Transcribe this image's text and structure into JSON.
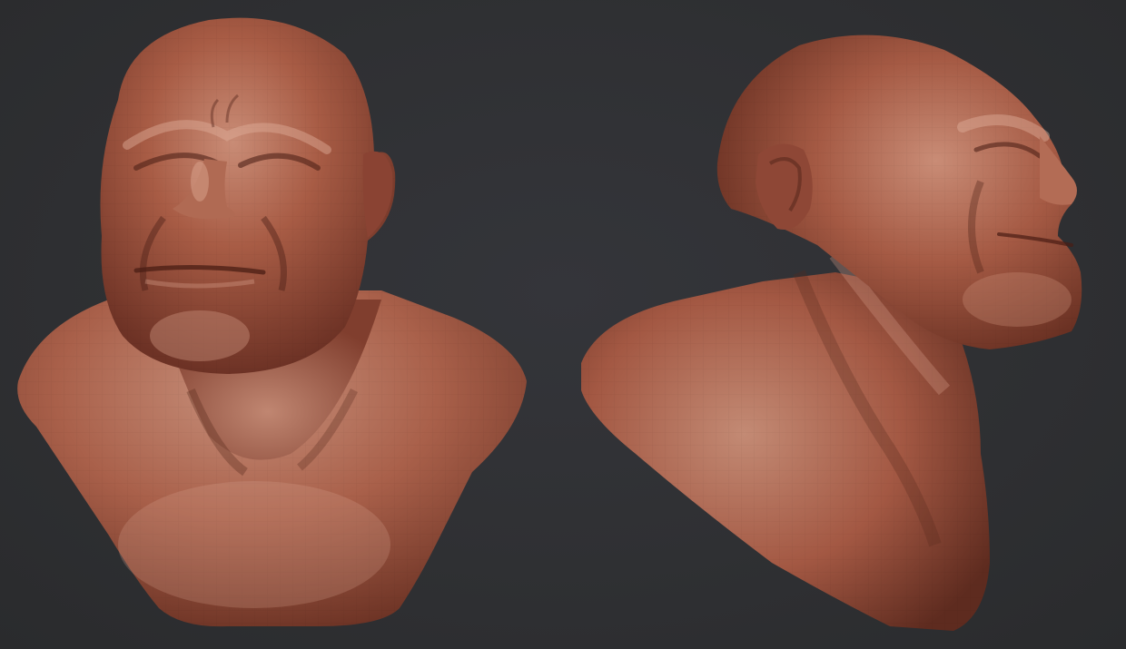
{
  "viewport": {
    "background": "#2e2f30"
  },
  "material": {
    "base": "#9b4f3a",
    "highlight": "#c98c76",
    "shadow": "#5a2a1e"
  },
  "views": [
    {
      "name": "front-view"
    },
    {
      "name": "side-view"
    }
  ]
}
